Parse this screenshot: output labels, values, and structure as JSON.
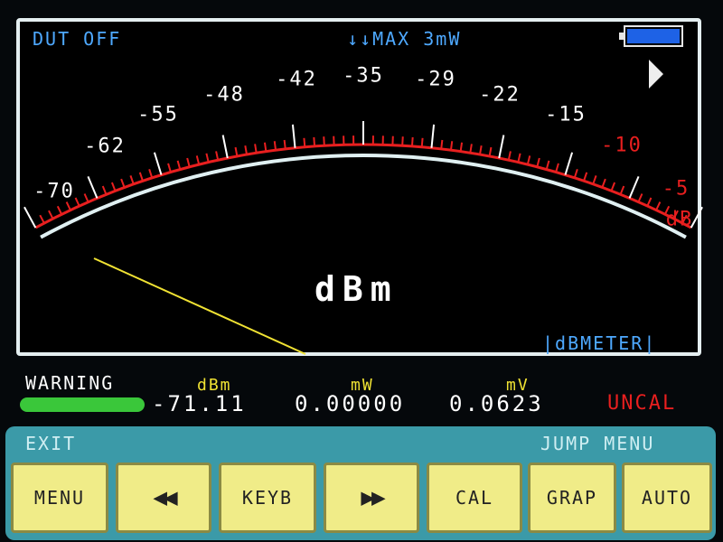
{
  "status": {
    "dut_state": "DUT OFF",
    "max_power": "↓↓MAX 3mW"
  },
  "meter": {
    "scale_labels": [
      "-70",
      "-62",
      "-55",
      "-48",
      "-42",
      "-35",
      "-29",
      "-22",
      "-15",
      "-10",
      "-5",
      "dB"
    ],
    "scale_label_colors": {
      "normal": "#ffffff",
      "warning": "#e81f1f"
    },
    "big_unit": "dBm",
    "mode_tag": "|dBMETER|",
    "arc_colors": {
      "scale": "#e81f1f",
      "inner": "#e0f0f2",
      "needle": "#f0e233"
    }
  },
  "readout": {
    "warning": "WARNING",
    "units": {
      "dbm": "dBm",
      "mw": "mW",
      "mv": "mV"
    },
    "values": {
      "dbm": "-71.11",
      "mw": "0.00000",
      "mv": "0.0623"
    },
    "uncal": "UNCAL"
  },
  "menu": {
    "exit_label": "EXIT",
    "jump_label": "JUMP MENU",
    "buttons": [
      {
        "label": "MENU",
        "icon": ""
      },
      {
        "label": "",
        "icon": "rewind-icon"
      },
      {
        "label": "KEYB",
        "icon": ""
      },
      {
        "label": "",
        "icon": "fast-forward-icon"
      },
      {
        "label": "CAL",
        "icon": ""
      },
      {
        "label": "GRAP",
        "icon": ""
      },
      {
        "label": "AUTO",
        "icon": ""
      }
    ]
  }
}
